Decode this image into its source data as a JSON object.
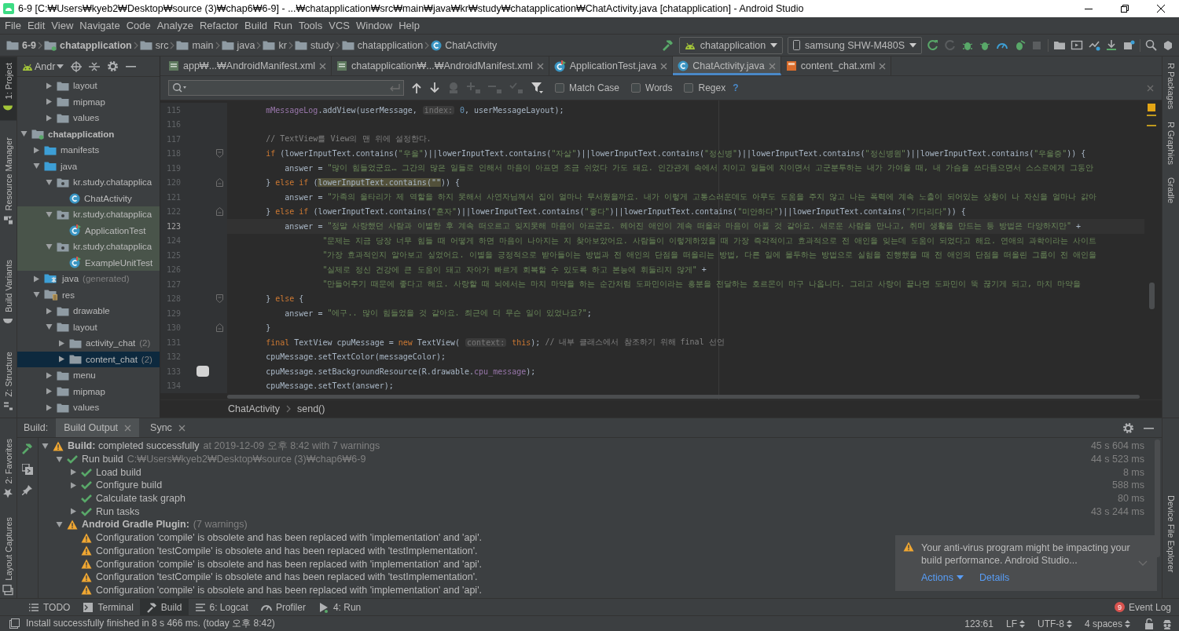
{
  "window": {
    "title": "6-9 [C:₩Users₩kyeb2₩Desktop₩source (3)₩chap6₩6-9] - ...₩chatapplication₩src₩main₩java₩kr₩study₩chatapplication₩ChatActivity.java [chatapplication] - Android Studio"
  },
  "menu": [
    "File",
    "Edit",
    "View",
    "Navigate",
    "Code",
    "Analyze",
    "Refactor",
    "Build",
    "Run",
    "Tools",
    "VCS",
    "Window",
    "Help"
  ],
  "navigation_bar": [
    {
      "label": "6-9",
      "kind": "project"
    },
    {
      "label": "chatapplication",
      "kind": "module"
    },
    {
      "label": "src",
      "kind": "folder"
    },
    {
      "label": "main",
      "kind": "folder"
    },
    {
      "label": "java",
      "kind": "folder"
    },
    {
      "label": "kr",
      "kind": "folder"
    },
    {
      "label": "study",
      "kind": "folder"
    },
    {
      "label": "chatapplication",
      "kind": "folder"
    },
    {
      "label": "ChatActivity",
      "kind": "class"
    }
  ],
  "toolbar": {
    "run_configuration": "chatapplication",
    "device": "samsung SHW-M480S"
  },
  "left_tool_tabs": {
    "upper": [
      {
        "tabs": [
          {
            "label": "1: Project",
            "selected": true
          },
          {
            "label": "Resource Manager",
            "selected": false
          }
        ]
      },
      {
        "tabs": [
          {
            "label": "Build Variants",
            "selected": false
          },
          {
            "label": "Z: Structure",
            "selected": false
          }
        ]
      }
    ],
    "lower": [
      {
        "tabs": [
          {
            "label": "2: Favorites",
            "selected": false
          },
          {
            "label": "Layout Captures",
            "selected": false
          }
        ]
      }
    ]
  },
  "right_tool_tabs": {
    "upper": [
      {
        "label": "R Packages",
        "selected": false
      },
      {
        "label": "R Graphics",
        "selected": false
      },
      {
        "label": "Gradle",
        "selected": false
      }
    ],
    "lower": [
      {
        "label": "Device File Explorer",
        "selected": false
      }
    ]
  },
  "project_panel": {
    "view": "Andr",
    "tree": [
      {
        "children": [
          {
            "children": [
              {
                "label": "layout",
                "kind": "folder",
                "expanded": false,
                "selected": false
              },
              {
                "label": "mipmap",
                "kind": "folder",
                "expanded": false,
                "selected": false
              },
              {
                "label": "values",
                "kind": "folder",
                "expanded": false,
                "selected": false
              }
            ]
          }
        ]
      },
      {
        "label": "chatapplication",
        "kind": "module",
        "expanded": true,
        "selected": false,
        "children": [
          {
            "label": "manifests",
            "kind": "source-folder",
            "expanded": false,
            "selected": false
          },
          {
            "label": "java",
            "kind": "source-folder",
            "expanded": true,
            "selected": false,
            "children": [
              {
                "label": "kr.study.chatapplica",
                "kind": "package",
                "expanded": true,
                "selected": false,
                "children": [
                  {
                    "label": "ChatActivity",
                    "kind": "class",
                    "selected": false
                  }
                ]
              },
              {
                "label": "kr.study.chatapplica",
                "kind": "test-package",
                "expanded": true,
                "selected": false,
                "children": [
                  {
                    "label": "ApplicationTest",
                    "kind": "test-class",
                    "selected": false
                  }
                ]
              },
              {
                "label": "kr.study.chatapplica",
                "kind": "test-package",
                "expanded": true,
                "selected": false,
                "children": [
                  {
                    "label": "ExampleUnitTest",
                    "kind": "test-class",
                    "selected": false
                  }
                ]
              }
            ]
          },
          {
            "label": "java",
            "note": "(generated)",
            "kind": "generated-folder",
            "expanded": false,
            "selected": false
          },
          {
            "label": "res",
            "kind": "resource-folder",
            "expanded": true,
            "selected": false,
            "children": [
              {
                "label": "drawable",
                "kind": "folder",
                "expanded": false,
                "selected": false
              },
              {
                "label": "layout",
                "kind": "folder",
                "expanded": true,
                "selected": false,
                "children": [
                  {
                    "label": "activity_chat",
                    "note": "(2)",
                    "kind": "folder",
                    "expanded": false,
                    "selected": false
                  },
                  {
                    "label": "content_chat",
                    "note": "(2)",
                    "kind": "folder",
                    "expanded": false,
                    "selected": true
                  }
                ]
              },
              {
                "label": "menu",
                "kind": "folder",
                "expanded": false,
                "selected": false
              },
              {
                "label": "mipmap",
                "kind": "folder",
                "expanded": false,
                "selected": false
              },
              {
                "label": "values",
                "kind": "folder",
                "expanded": false,
                "selected": false
              }
            ]
          }
        ]
      }
    ]
  },
  "editor_tabs": [
    {
      "label": "app₩...₩AndroidManifest.xml",
      "kind": "manifest",
      "selected": false
    },
    {
      "label": "chatapplication₩...₩AndroidManifest.xml",
      "kind": "manifest",
      "selected": false
    },
    {
      "label": "ApplicationTest.java",
      "kind": "test-class",
      "selected": false
    },
    {
      "label": "ChatActivity.java",
      "kind": "class",
      "selected": true
    },
    {
      "label": "content_chat.xml",
      "kind": "layout",
      "selected": false
    }
  ],
  "find_bar": {
    "options": [
      {
        "label": "Match Case",
        "checked": false
      },
      {
        "label": "Words",
        "checked": false
      },
      {
        "label": "Regex",
        "checked": false
      }
    ],
    "help": "?"
  },
  "code_lines": [
    {
      "number": "115",
      "kind": "plain",
      "current": false,
      "tokens": [
        {
          "kind": "field",
          "text": "        mMessageLog"
        },
        {
          "kind": "plain",
          "text": ".addView(userMessage, "
        },
        {
          "kind": "hint",
          "text": "index:"
        },
        {
          "kind": "number",
          "text": " 0"
        },
        {
          "kind": "plain",
          "text": ", userMessageLayout);"
        }
      ]
    },
    {
      "number": "116",
      "kind": "plain",
      "current": false
    },
    {
      "number": "117",
      "kind": "plain",
      "current": false,
      "tokens": [
        {
          "kind": "comment",
          "text": "        // TextView를 View의 맨 위에 설정한다."
        }
      ]
    },
    {
      "number": "118",
      "kind": "fold-start",
      "current": false,
      "tokens": [
        {
          "kind": "keyword",
          "text": "        if"
        },
        {
          "kind": "plain",
          "text": " (lowerInputText.contains("
        },
        {
          "kind": "string",
          "text": "\"우울\""
        },
        {
          "kind": "plain",
          "text": ")||lowerInputText.contains("
        },
        {
          "kind": "string",
          "text": "\"자살\""
        },
        {
          "kind": "plain",
          "text": ")||lowerInputText.contains("
        },
        {
          "kind": "string",
          "text": "\"정신병\""
        },
        {
          "kind": "plain",
          "text": ")||lowerInputText.contains("
        },
        {
          "kind": "string",
          "text": "\"정신병원\""
        },
        {
          "kind": "plain",
          "text": ")||lowerInputText.contains("
        },
        {
          "kind": "string",
          "text": "\"우울증\""
        },
        {
          "kind": "plain",
          "text": ")) {"
        }
      ]
    },
    {
      "number": "119",
      "kind": "plain",
      "current": false,
      "tokens": [
        {
          "kind": "plain",
          "text": "            answer = "
        },
        {
          "kind": "string",
          "text": "\"많이 힘들었군요… 그간의 많은 일들로 인해서 마음이 아프면 조금 쉬었다 가도 돼요. 인간관계 속에서 치이고 일들에 치이면서 고군분투하는 내가 가여울 때, 내 가슴을 쓰다듬으면서 스스로에게 그동안"
        }
      ]
    },
    {
      "number": "120",
      "kind": "fold-end",
      "current": false,
      "tokens": [
        {
          "kind": "plain",
          "text": "        } "
        },
        {
          "kind": "keyword",
          "text": "else if"
        },
        {
          "kind": "plain",
          "text": " ("
        },
        {
          "kind": "match",
          "text": "lowerInputText.contains(\"\""
        },
        {
          "kind": "plain",
          "text": ")) {"
        }
      ]
    },
    {
      "number": "121",
      "kind": "plain",
      "current": false,
      "tokens": [
        {
          "kind": "plain",
          "text": "            answer = "
        },
        {
          "kind": "string",
          "text": "\"가족의 울타리가 제 역할을 하지 못해서 사연자님께서 집이 얼마나 무서웠을까요. 내가 이렇게 고통스러운데도 아무도 도움을 주지 않고 나는 폭력에 계속 노출이 되어있는 상황이 나 자신을 얼마나 갉아"
        }
      ]
    },
    {
      "number": "122",
      "kind": "fold-end",
      "current": false,
      "tokens": [
        {
          "kind": "plain",
          "text": "        } "
        },
        {
          "kind": "keyword",
          "text": "else if"
        },
        {
          "kind": "plain",
          "text": " (lowerInputText.contains("
        },
        {
          "kind": "string",
          "text": "\"혼자\""
        },
        {
          "kind": "plain",
          "text": ")||lowerInputText.contains("
        },
        {
          "kind": "string",
          "text": "\"좋다\""
        },
        {
          "kind": "plain",
          "text": ")||lowerInputText.contains("
        },
        {
          "kind": "string",
          "text": "\"미안하다\""
        },
        {
          "kind": "plain",
          "text": ")||lowerInputText.contains("
        },
        {
          "kind": "string",
          "text": "\"기다리다\""
        },
        {
          "kind": "plain",
          "text": ")) {"
        }
      ]
    },
    {
      "number": "123",
      "kind": "plain",
      "current": true,
      "tokens": [
        {
          "kind": "plain",
          "text": "            answer = "
        },
        {
          "kind": "string",
          "text": "\"정말 사랑했던 사람과 이별한 후 계속 떠오르고 잊지못해 마음이 아프군요. 헤어진 애인이 계속 떠올라 마음이 아플 것 같아요. 새로운 사람을 만나고, 취미 생활을 만드는 등 방법은 다양하지만\""
        },
        {
          "kind": "plain",
          "text": " +"
        }
      ]
    },
    {
      "number": "124",
      "kind": "plain",
      "current": false,
      "tokens": [
        {
          "kind": "string",
          "text": "                    \"문제는 지금 당장 너무 힘들 때 어떻게 하면 마음이 나아지는 지 찾아보았어요. 사람들이 이렇게하였을 때 가장 즉각적이고 효과적으로 전 애인을 잊는데 도움이 되었다고 해요. 연애의 과학이라는 사이트"
        }
      ]
    },
    {
      "number": "125",
      "kind": "plain",
      "current": false,
      "tokens": [
        {
          "kind": "string",
          "text": "                    \"가장 효과적인지 알아보고 싶었어요. 이별을 긍정적으로 받아들이는 방법과 전 애인의 단점을 떠올리는 방법, 다른 일에 몰두하는 방법으로 실험을 진행했을 때 전 애인의 단점을 떠올린 그룹이 전 애인을"
        }
      ]
    },
    {
      "number": "126",
      "kind": "plain",
      "current": false,
      "tokens": [
        {
          "kind": "string",
          "text": "                    \"실제로 정신 건강에 큰 도움이 돼고 자아가 빠르게 회복할 수 있도록 하고 본능에 휘둘리지 않게\""
        },
        {
          "kind": "plain",
          "text": " +"
        }
      ]
    },
    {
      "number": "127",
      "kind": "plain",
      "current": false,
      "tokens": [
        {
          "kind": "string",
          "text": "                    \"만들어주기 때문에 좋다고 해요. 사랑할 때 뇌에서는 마치 마약을 하는 순간처럼 도파민이라는 흥분을 전달하는 호르몬이 마구 나옵니다. 그리고 사랑이 끝나면 도파민이 뚝 끊기게 되고, 마치 마약을"
        }
      ]
    },
    {
      "number": "128",
      "kind": "fold-start",
      "current": false,
      "tokens": [
        {
          "kind": "plain",
          "text": "        } "
        },
        {
          "kind": "keyword",
          "text": "else"
        },
        {
          "kind": "plain",
          "text": " {"
        }
      ]
    },
    {
      "number": "129",
      "kind": "plain",
      "current": false,
      "tokens": [
        {
          "kind": "plain",
          "text": "            answer = "
        },
        {
          "kind": "string",
          "text": "\"에구.. 많이 힘들었을 것 같아요. 최근에 더 무슨 일이 있었나요?\""
        },
        {
          "kind": "plain",
          "text": ";"
        }
      ]
    },
    {
      "number": "130",
      "kind": "fold-end",
      "current": false,
      "tokens": [
        {
          "kind": "plain",
          "text": "        }"
        }
      ]
    },
    {
      "number": "131",
      "kind": "plain",
      "current": false,
      "tokens": [
        {
          "kind": "keyword",
          "text": "        final"
        },
        {
          "kind": "plain",
          "text": " TextView cpuMessage = "
        },
        {
          "kind": "keyword",
          "text": "new"
        },
        {
          "kind": "plain",
          "text": " TextView( "
        },
        {
          "kind": "hint",
          "text": "context:"
        },
        {
          "kind": "keyword",
          "text": " this"
        },
        {
          "kind": "plain",
          "text": "); "
        },
        {
          "kind": "comment",
          "text": "// 내부 클래스에서 참조하기 위해 final 선언"
        }
      ]
    },
    {
      "number": "132",
      "kind": "plain",
      "current": false,
      "tokens": [
        {
          "kind": "plain",
          "text": "        cpuMessage.setTextColor(messageColor);"
        }
      ]
    },
    {
      "number": "133",
      "kind": "note",
      "current": false,
      "tokens": [
        {
          "kind": "plain",
          "text": "        cpuMessage.setBackgroundResource(R.drawable."
        },
        {
          "kind": "field",
          "text": "cpu_message"
        },
        {
          "kind": "plain",
          "text": ");"
        }
      ]
    },
    {
      "number": "134",
      "kind": "plain",
      "current": false,
      "tokens": [
        {
          "kind": "plain",
          "text": "        cpuMessage.setText(answer);"
        }
      ]
    }
  ],
  "editor_breadcrumb": [
    "ChatActivity",
    "send()"
  ],
  "build_panel": {
    "label": "Build:",
    "tabs": [
      {
        "label": "Build Output",
        "selected": true
      },
      {
        "label": "Sync",
        "selected": false
      }
    ],
    "tree": [
      {
        "label": "**Build:** completed successfully",
        "detail": "at 2019-12-09 오후 8:42  with 7 warnings",
        "time": "45 s 604 ms",
        "kind": "warning",
        "expanded": true,
        "children": [
          {
            "label": "Run build",
            "detail": "C:₩Users₩kyeb2₩Desktop₩source (3)₩chap6₩6-9",
            "time": "44 s 523 ms",
            "kind": "success",
            "expanded": true,
            "children": [
              {
                "label": "Load build",
                "time": "8 ms",
                "kind": "success",
                "expanded": false
              },
              {
                "label": "Configure build",
                "time": "588 ms",
                "kind": "success",
                "expanded": false
              },
              {
                "label": "Calculate task graph",
                "time": "80 ms",
                "kind": "success"
              },
              {
                "label": "Run tasks",
                "time": "43 s 244 ms",
                "kind": "success",
                "expanded": false
              }
            ]
          },
          {
            "label": "**Android Gradle Plugin:**",
            "detail": "(7 warnings)",
            "kind": "warning",
            "expanded": true,
            "children": [
              {
                "label": "Configuration 'compile' is obsolete and has been replaced with 'implementation' and 'api'.",
                "kind": "warning"
              },
              {
                "label": "Configuration 'testCompile' is obsolete and has been replaced with 'testImplementation'.",
                "kind": "warning"
              },
              {
                "label": "Configuration 'compile' is obsolete and has been replaced with 'implementation' and 'api'.",
                "kind": "warning"
              },
              {
                "label": "Configuration 'testCompile' is obsolete and has been replaced with 'testImplementation'.",
                "kind": "warning"
              },
              {
                "label": "Configuration 'compile' is obsolete and has been replaced with 'implementation' and 'api'.",
                "kind": "warning"
              }
            ]
          }
        ]
      }
    ],
    "notification": {
      "text": "Your anti-virus program might be impacting your build performance. Android Studio...",
      "actions": [
        {
          "label": "Actions",
          "kind": "menu"
        },
        {
          "label": "Details",
          "kind": "link"
        }
      ]
    }
  },
  "bottom_tool_tabs": [
    {
      "label": "TODO",
      "selected": false
    },
    {
      "label": "Terminal",
      "selected": false
    },
    {
      "label": "Build",
      "selected": true
    },
    {
      "label": "6: Logcat",
      "selected": false
    },
    {
      "label": "Profiler",
      "selected": false
    },
    {
      "label": "4: Run",
      "selected": false
    }
  ],
  "event_log": {
    "label": "Event Log",
    "count": "9"
  },
  "status_bar": {
    "message": "Install successfully finished in 8 s 466 ms. (today 오후 8:42)",
    "items": [
      {
        "label": "123:61",
        "kind": "text"
      },
      {
        "label": "LF",
        "kind": "select"
      },
      {
        "label": "UTF-8",
        "kind": "select"
      },
      {
        "label": "4 spaces",
        "kind": "select"
      }
    ]
  }
}
